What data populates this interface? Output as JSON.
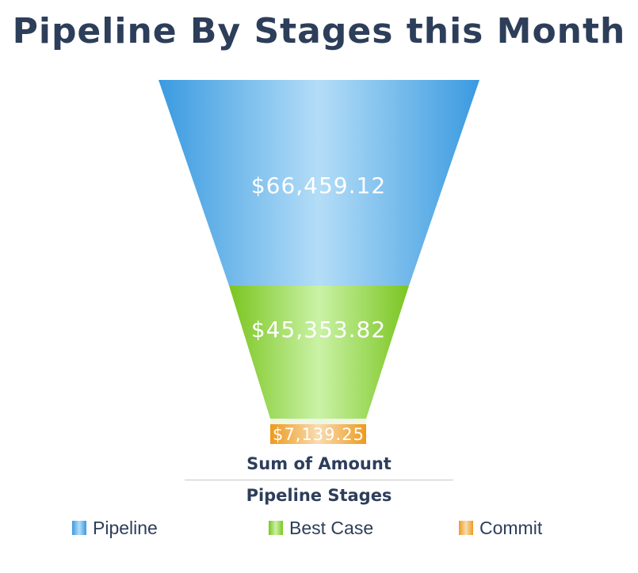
{
  "chart_data": {
    "type": "funnel",
    "title": "Pipeline By Stages this Month",
    "value_axis_label": "Sum of Amount",
    "category_axis_label": "Pipeline Stages",
    "categories": [
      "Pipeline",
      "Best Case",
      "Commit"
    ],
    "values": [
      66459.12,
      45353.82,
      7139.25
    ],
    "labels": [
      "$66,459.12",
      "$45,353.82",
      "$7,139.25"
    ],
    "colors": {
      "Pipeline": [
        "#3a9ae0",
        "#b4ddf7"
      ],
      "Best Case": [
        "#7ac520",
        "#caf2a6"
      ],
      "Commit": [
        "#ee9a1e",
        "#f8dcb1"
      ]
    },
    "legend_position": "bottom"
  }
}
